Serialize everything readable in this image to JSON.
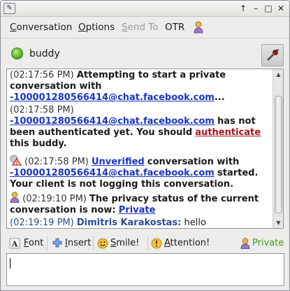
{
  "window": {
    "controls": {
      "keep_above": "↑",
      "minimize": "✕",
      "maximize": "□",
      "close": "✕"
    }
  },
  "menubar": {
    "conversation": {
      "pre": "C",
      "rest": "onversation"
    },
    "options": {
      "pre": "O",
      "rest": "ptions"
    },
    "send_to": {
      "pre": "S",
      "rest": "end To"
    },
    "otr": "OTR"
  },
  "buddy": {
    "name": "buddy",
    "status": "available"
  },
  "messages": [
    {
      "timestamp": "(02:17:56 PM)",
      "text_a": "Attempting to start a private conversation with",
      "link": "-100001280566414@chat.facebook.com",
      "text_b": "..."
    },
    {
      "timestamp": "(02:17:58 PM)",
      "link": "-100001280566414@chat.facebook.com",
      "text_a": "has not been authenticated yet.  You should",
      "action_link": "authenticate",
      "text_b": "this buddy."
    },
    {
      "timestamp": "(02:17:58 PM)",
      "link_a": "Unverified",
      "text_a": "conversation with",
      "link_b": "-100001280566414@chat.facebook.com",
      "text_b": "started.  Your client is not logging this conversation."
    },
    {
      "timestamp": "(02:19:10 PM)",
      "text_a": "The privacy status of the current conversation is now:",
      "link": "Private"
    },
    {
      "timestamp": "(02:19:19 PM)",
      "sender": "Dimitris Karakostas:",
      "text": "hello"
    }
  ],
  "toolbar": {
    "font": {
      "pre": "F",
      "rest": "ont"
    },
    "insert": {
      "pre": "I",
      "rest": "nsert"
    },
    "smile": {
      "pre": "S",
      "rest": "mile!"
    },
    "attention": {
      "pre": "A",
      "rest": "ttention!"
    },
    "otr_status": "Private"
  },
  "entry": {
    "value": ""
  },
  "colors": {
    "link": "#1a35c2",
    "link_red": "#a2161a",
    "sender": "#2c4a96",
    "private_green": "#3f9b22",
    "online_green": "#5bb82c"
  },
  "icons": {
    "app": "pidgin-app-icon",
    "status": "available-status-icon",
    "avatar": "buddy-avatar-icon",
    "otr": "otr-person-icon",
    "warning": "warning-triangle-icon",
    "font": "font-icon",
    "insert": "insert-plus-icon",
    "smile": "smiley-icon",
    "attention": "attention-icon"
  }
}
